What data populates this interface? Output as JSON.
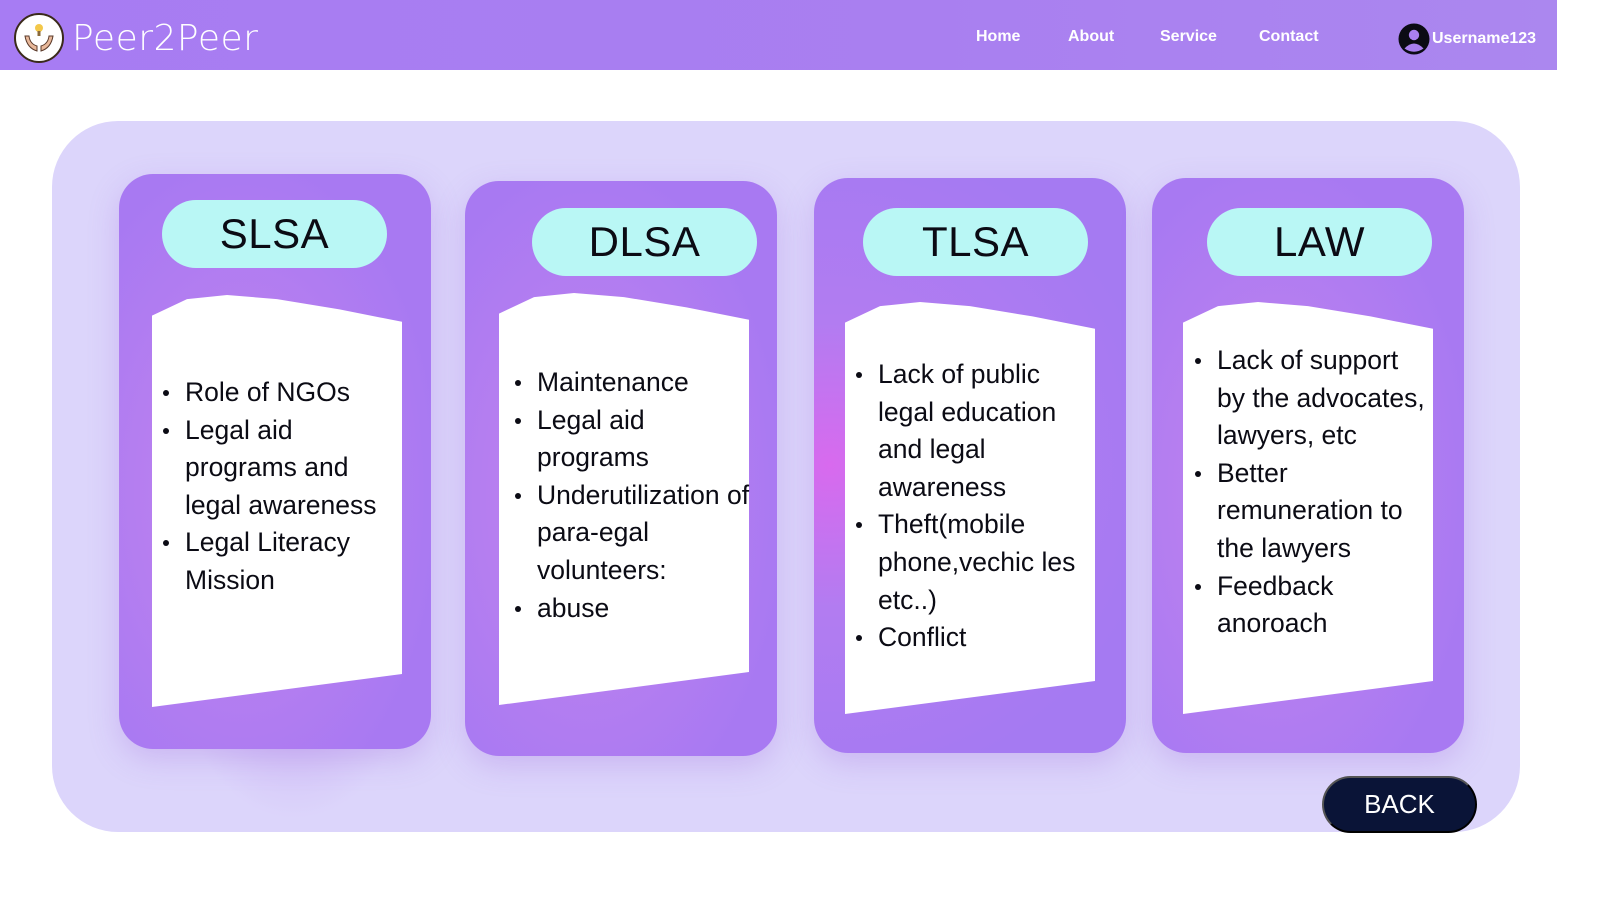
{
  "brand": {
    "name": "Peer2Peer"
  },
  "nav": {
    "home": "Home",
    "about": "About",
    "service": "Service",
    "contact": "Contact"
  },
  "user": {
    "name": "Username123"
  },
  "cards": [
    {
      "title": "SLSA",
      "items": [
        "Role of NGOs",
        "Legal aid programs and legal awareness",
        "Legal Literacy Mission"
      ]
    },
    {
      "title": "DLSA",
      "items": [
        "Maintenance",
        "Legal aid programs",
        "Underutilization of para-egal volunteers:",
        "abuse"
      ]
    },
    {
      "title": "TLSA",
      "items": [
        "Lack of public legal education and legal awareness",
        "Theft(mobile phone,vechic les etc..)",
        "Conflict"
      ]
    },
    {
      "title": "LAW",
      "items": [
        "Lack of support by the advocates, lawyers, etc",
        "Better remuneration to the lawyers",
        "Feedback anoroach"
      ]
    }
  ],
  "back_button": "BACK",
  "colors": {
    "navbar": "#a77cf3",
    "panel": "#dcd5fb",
    "title_pill": "#b9f7f5",
    "back": "#0a1437"
  }
}
